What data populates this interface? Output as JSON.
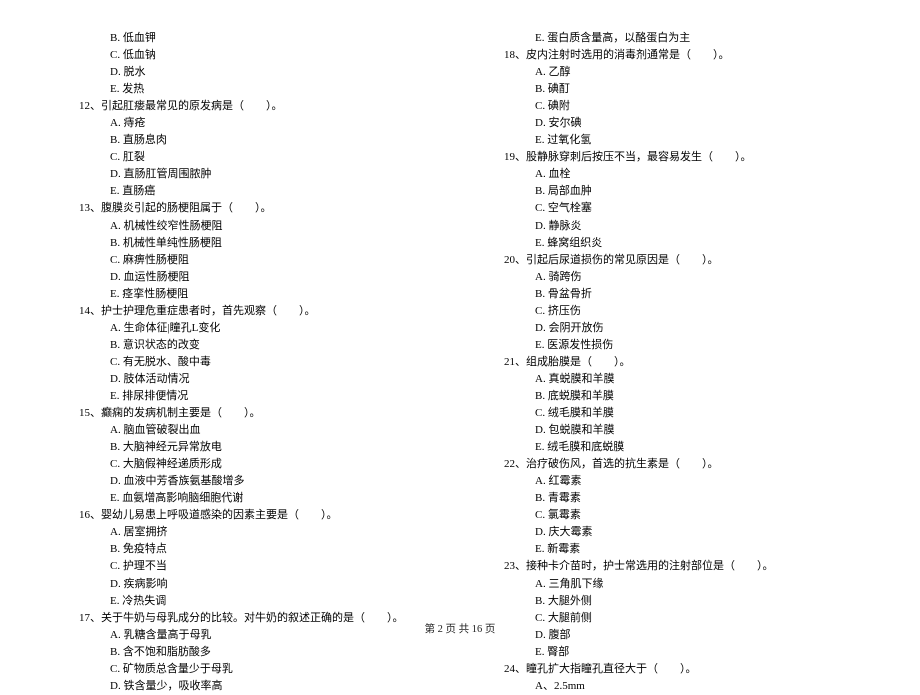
{
  "left": {
    "q11_options": [
      "B. 低血钾",
      "C. 低血钠",
      "D. 脱水",
      "E. 发热"
    ],
    "q12": {
      "stem": "12、引起肛瘘最常见的原发病是（　　）。",
      "options": [
        "A. 痔疮",
        "B. 直肠息肉",
        "C. 肛裂",
        "D. 直肠肛管周围脓肿",
        "E. 直肠癌"
      ]
    },
    "q13": {
      "stem": "13、腹膜炎引起的肠梗阻属于（　　）。",
      "options": [
        "A. 机械性绞窄性肠梗阻",
        "B. 机械性单纯性肠梗阻",
        "C. 麻痹性肠梗阻",
        "D. 血运性肠梗阻",
        "E. 痉挛性肠梗阻"
      ]
    },
    "q14": {
      "stem": "14、护士护理危重症患者时，首先观察（　　）。",
      "options": [
        "A. 生命体征|瞳孔L变化",
        "B. 意识状态的改变",
        "C. 有无脱水、酸中毒",
        "D. 肢体活动情况",
        "E. 排尿排便情况"
      ]
    },
    "q15": {
      "stem": "15、癫痫的发病机制主要是（　　）。",
      "options": [
        "A. 脑血管破裂出血",
        "B. 大脑神经元异常放电",
        "C. 大脑假神经递质形成",
        "D. 血液中芳香族氨基酸增多",
        "E. 血氨增高影响脑细胞代谢"
      ]
    },
    "q16": {
      "stem": "16、婴幼儿易患上呼吸道感染的因素主要是（　　）。",
      "options": [
        "A. 居室拥挤",
        "B. 免疫特点",
        "C. 护理不当",
        "D. 疾病影响",
        "E. 冷热失调"
      ]
    },
    "q17": {
      "stem": "17、关于牛奶与母乳成分的比较。对牛奶的叙述正确的是（　　）。",
      "options": [
        "A. 乳糖含量高于母乳",
        "B. 含不饱和脂肪酸多",
        "C. 矿物质总含量少于母乳",
        "D. 铁含量少，吸收率高"
      ]
    }
  },
  "right": {
    "q17e": "E. 蛋白质含量高，以酪蛋白为主",
    "q18": {
      "stem": "18、皮内注射时选用的消毒剂通常是（　　）。",
      "options": [
        "A. 乙醇",
        "B. 碘酊",
        "C. 碘附",
        "D. 安尔碘",
        "E. 过氧化氢"
      ]
    },
    "q19": {
      "stem": "19、股静脉穿刺后按压不当，最容易发生（　　）。",
      "options": [
        "A. 血栓",
        "B. 局部血肿",
        "C. 空气栓塞",
        "D. 静脉炎",
        "E. 蜂窝组织炎"
      ]
    },
    "q20": {
      "stem": "20、引起后尿道损伤的常见原因是（　　）。",
      "options": [
        "A. 骑跨伤",
        "B. 骨盆骨折",
        "C. 挤压伤",
        "D. 会阴开放伤",
        "E. 医源发性损伤"
      ]
    },
    "q21": {
      "stem": "21、组成胎膜是（　　）。",
      "options": [
        "A. 真蜕膜和羊膜",
        "B. 底蜕膜和羊膜",
        "C. 绒毛膜和羊膜",
        "D. 包蜕膜和羊膜",
        "E. 绒毛膜和底蜕膜"
      ]
    },
    "q22": {
      "stem": "22、治疗破伤风，首选的抗生素是（　　）。",
      "options": [
        "A. 红霉素",
        "B. 青霉素",
        "C. 氯霉素",
        "D. 庆大霉素",
        "E. 新霉素"
      ]
    },
    "q23": {
      "stem": "23、接种卡介苗时，护士常选用的注射部位是（　　）。",
      "options": [
        "A. 三角肌下缘",
        "B. 大腿外侧",
        "C. 大腿前侧",
        "D. 腹部",
        "E. 臀部"
      ]
    },
    "q24": {
      "stem": "24、瞳孔扩大指瞳孔直径大于（　　）。",
      "options": [
        "A、2.5mm"
      ]
    }
  },
  "footer": "第 2 页 共 16 页"
}
